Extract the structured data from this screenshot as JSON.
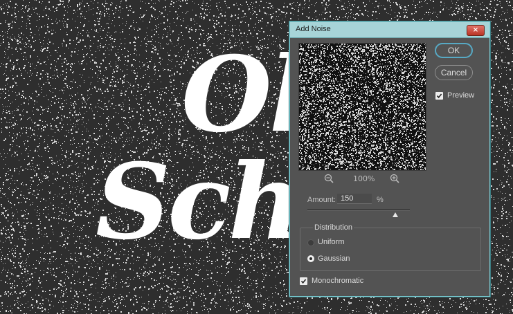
{
  "background": {
    "line1": "Ol",
    "line2": "Sch"
  },
  "dialog": {
    "title": "Add Noise",
    "close_glyph": "×",
    "ok_label": "OK",
    "cancel_label": "Cancel",
    "preview_label": "Preview",
    "preview_checked": true,
    "zoom_level": "100%",
    "amount_label": "Amount:",
    "amount_value": "150",
    "amount_unit": "%",
    "amount_slider_fraction": 0.86,
    "distribution": {
      "title": "Distribution",
      "options": [
        "Uniform",
        "Gaussian"
      ],
      "selected": "Gaussian"
    },
    "monochromatic_label": "Monochromatic",
    "monochromatic_checked": true,
    "icons": {
      "zoom_out": "zoom-out-icon",
      "zoom_in": "zoom-in-icon",
      "check": "check-icon"
    }
  },
  "colors": {
    "dialog_bg": "#535353",
    "title_bar": "#a7d4d8",
    "ok_border": "#57a9c4",
    "close_red": "#c8473a"
  }
}
